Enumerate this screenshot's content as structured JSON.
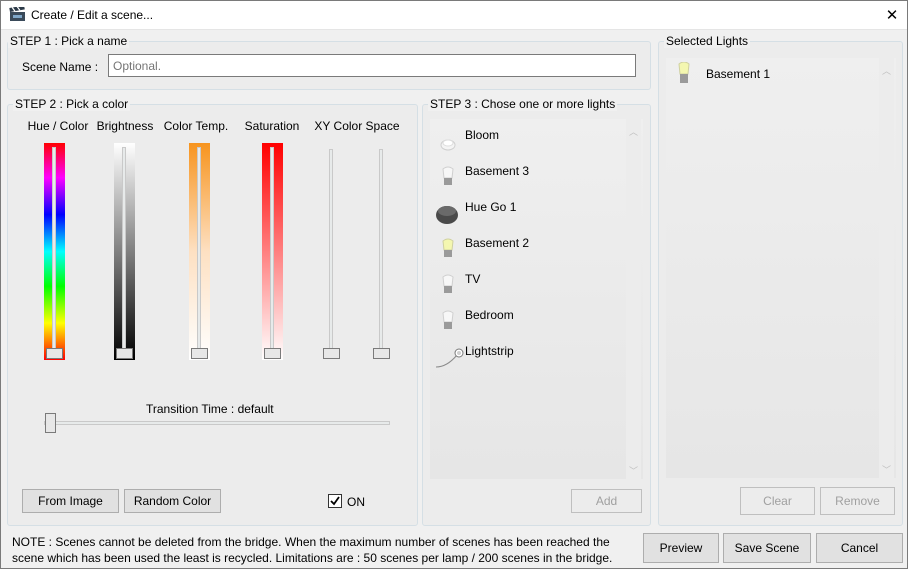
{
  "window": {
    "title": "Create / Edit a scene...",
    "close_symbol": "✕"
  },
  "step1": {
    "label": "STEP 1 : Pick a name",
    "scene_name_label": "Scene Name :",
    "scene_name_value": "",
    "scene_name_placeholder": "Optional."
  },
  "step2": {
    "label": "STEP 2 : Pick a color",
    "sliders": {
      "hue": {
        "label": "Hue / Color"
      },
      "brightness": {
        "label": "Brightness"
      },
      "color_temp": {
        "label": "Color Temp."
      },
      "saturation": {
        "label": "Saturation"
      },
      "xy": {
        "label": "XY Color Space"
      }
    },
    "transition_label": "Transition Time : default",
    "from_image_label": "From Image",
    "random_color_label": "Random Color",
    "on_label": "ON",
    "on_checked": true
  },
  "step3": {
    "label": "STEP 3 : Chose one or more lights",
    "lights": [
      {
        "name": "Bloom",
        "icon": "bloom-icon"
      },
      {
        "name": "Basement 3",
        "icon": "bulb-icon"
      },
      {
        "name": "Hue Go 1",
        "icon": "hue-go-icon"
      },
      {
        "name": "Basement 2",
        "icon": "bulb-on-icon"
      },
      {
        "name": "TV",
        "icon": "bulb-icon"
      },
      {
        "name": "Bedroom",
        "icon": "bulb-icon"
      },
      {
        "name": "Lightstrip",
        "icon": "lightstrip-icon"
      }
    ],
    "add_label": "Add"
  },
  "selected": {
    "label": "Selected Lights",
    "lights": [
      {
        "name": "Basement 1",
        "icon": "bulb-on-icon"
      }
    ],
    "clear_label": "Clear",
    "remove_label": "Remove"
  },
  "footer": {
    "note_line1": "NOTE : Scenes cannot be deleted from the bridge. When the maximum number of scenes has been reached the",
    "note_line2": "scene which has been used the least is recycled. Limitations are : 50 scenes per lamp / 200 scenes in the bridge.",
    "preview_label": "Preview",
    "save_label": "Save Scene",
    "cancel_label": "Cancel"
  }
}
